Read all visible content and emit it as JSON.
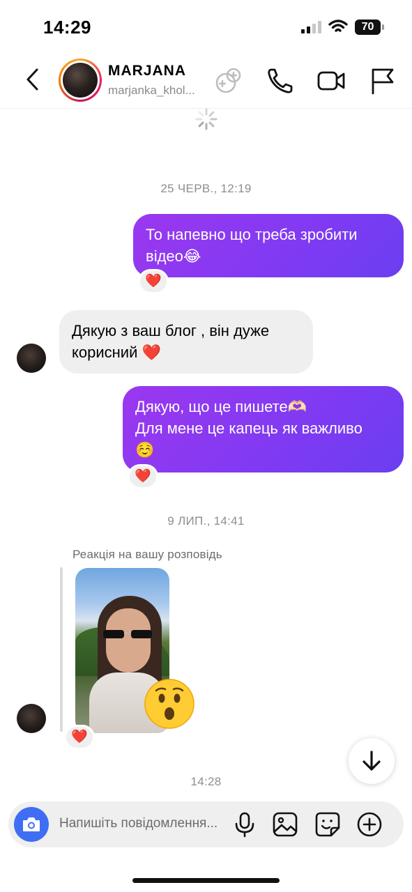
{
  "status_bar": {
    "time": "14:29",
    "battery": "70"
  },
  "header": {
    "name": "MARJANA",
    "handle": "marjanka_khol...",
    "icons": [
      "back-icon",
      "profile-avatar",
      "game-controller-icon",
      "phone-call-icon",
      "video-call-icon",
      "flag-icon"
    ]
  },
  "thread": {
    "timestamp_1": "25 ЧЕРВ., 12:19",
    "msg1": {
      "lines": [
        "То напевно що треба зробити",
        "відео😂"
      ],
      "reaction": "❤️"
    },
    "msg2": {
      "lines": [
        "Дякую з ваш блог , він дуже",
        "корисний ❤️"
      ]
    },
    "msg3": {
      "lines": [
        "Дякую, що це пишете🫶🏻",
        "Для мене це капець як важливо",
        "☺️"
      ],
      "reaction": "❤️"
    },
    "timestamp_2": "9 ЛИП., 14:41",
    "story_reply": {
      "label": "Реакція на вашу розповідь",
      "reaction_emoji": "😮",
      "reaction": "❤️"
    },
    "timestamp_3": "14:28"
  },
  "composer": {
    "placeholder": "Напишіть повідомлення...",
    "icons": [
      "camera-icon",
      "microphone-icon",
      "gallery-icon",
      "sticker-icon",
      "plus-icon"
    ]
  },
  "colors": {
    "outgoing_bubble": "#8a39f1",
    "incoming_bubble": "#efefef",
    "camera_button": "#3f6ef5",
    "heart": "#ed1c2e"
  }
}
